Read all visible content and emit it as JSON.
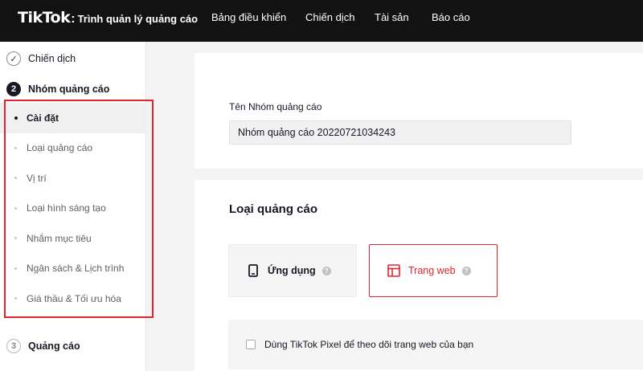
{
  "app": {
    "logo_text": "TikTok",
    "logo_colon": ":",
    "logo_subtitle": "Trình quản lý quảng cáo"
  },
  "nav": {
    "items": [
      "Bảng điều khiển",
      "Chiến dịch",
      "Tài sản",
      "Báo cáo"
    ]
  },
  "sidebar": {
    "steps": [
      {
        "number": "✓",
        "label": "Chiến dịch",
        "state": "done"
      },
      {
        "number": "2",
        "label": "Nhóm quảng cáo",
        "state": "active"
      },
      {
        "number": "3",
        "label": "Quảng cáo",
        "state": "pending"
      }
    ],
    "substeps": [
      "Cài đặt",
      "Loại quảng cáo",
      "Vị trí",
      "Loại hình sáng tạo",
      "Nhắm mục tiêu",
      "Ngân sách & Lịch trình",
      "Giá thầu & Tối ưu hóa"
    ],
    "current_substep": "Cài đặt",
    "highlight_color": "#e0242c"
  },
  "adgroup": {
    "name_label": "Tên Nhóm quảng cáo",
    "name_value": "Nhóm quảng cáo 20220721034243"
  },
  "ad_type": {
    "title": "Loại quảng cáo",
    "options": [
      {
        "label": "Ứng dụng",
        "icon": "mobile-icon",
        "selected": false
      },
      {
        "label": "Trang web",
        "icon": "webpage-icon",
        "selected": true
      }
    ],
    "help_glyph": "?",
    "pixel_checkbox_label": "Dùng TikTok Pixel để theo dõi trang web của bạn",
    "pixel_checked": false
  },
  "colors": {
    "accent": "#e0242c",
    "topbar": "#121212"
  }
}
